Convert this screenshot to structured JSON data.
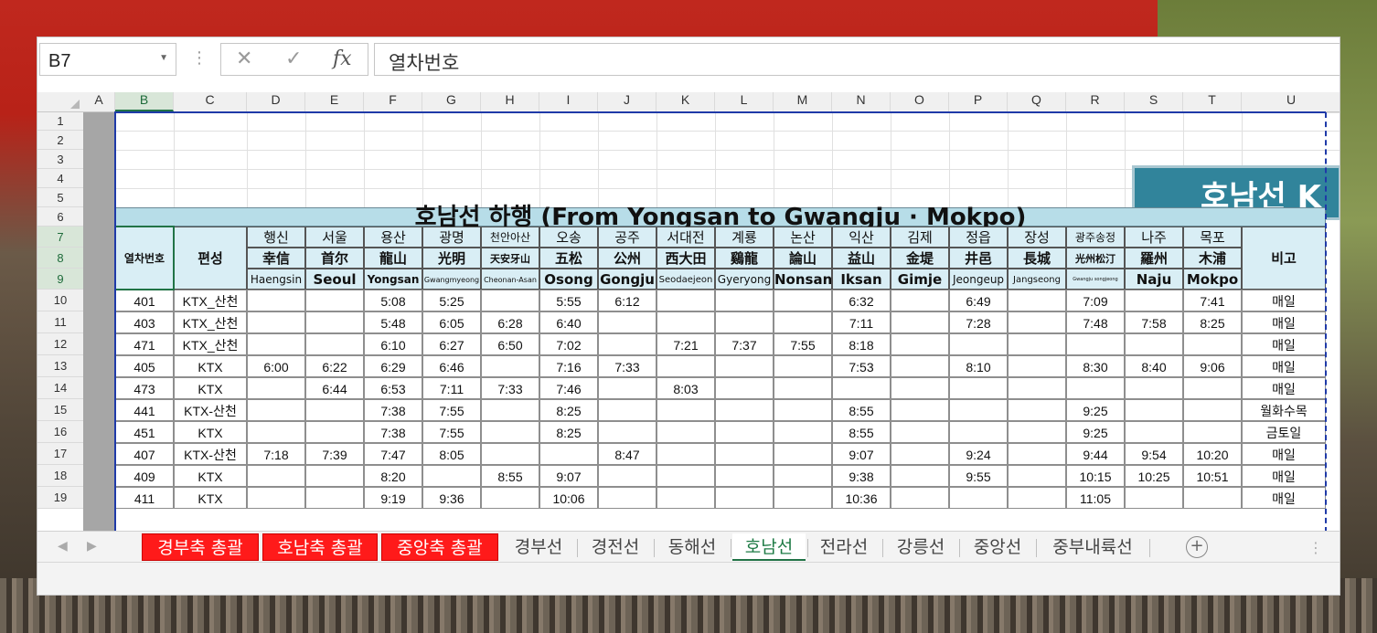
{
  "formula_bar": {
    "name_box": "B7",
    "formula": "열차번호"
  },
  "columns": [
    "A",
    "B",
    "C",
    "D",
    "E",
    "F",
    "G",
    "H",
    "I",
    "J",
    "K",
    "L",
    "M",
    "N",
    "O",
    "P",
    "Q",
    "R",
    "S",
    "T",
    "U"
  ],
  "rows": [
    "1",
    "2",
    "3",
    "4",
    "5",
    "6",
    "7",
    "8",
    "9",
    "10",
    "11",
    "12",
    "13",
    "14",
    "15",
    "16",
    "17",
    "18",
    "19"
  ],
  "banner": "호남선 K",
  "title": "호남선 하행 (From Yongsan to Gwangju · Mokpo)",
  "header": {
    "train_no": "열차번호",
    "train_type": "편성",
    "remarks": "비고",
    "stations": [
      {
        "ko": "행신",
        "hanja": "幸信",
        "en": "Haengsin"
      },
      {
        "ko": "서울",
        "hanja": "首尔",
        "en": "Seoul"
      },
      {
        "ko": "용산",
        "hanja": "龍山",
        "en": "Yongsan"
      },
      {
        "ko": "광명",
        "hanja": "光明",
        "en": "Gwangmyeong"
      },
      {
        "ko": "천안아산",
        "hanja": "天安牙山",
        "en": "Cheonan-Asan"
      },
      {
        "ko": "오송",
        "hanja": "五松",
        "en": "Osong"
      },
      {
        "ko": "공주",
        "hanja": "公州",
        "en": "Gongju"
      },
      {
        "ko": "서대전",
        "hanja": "西大田",
        "en": "Seodaejeon"
      },
      {
        "ko": "계룡",
        "hanja": "鷄龍",
        "en": "Gyeryong"
      },
      {
        "ko": "논산",
        "hanja": "論山",
        "en": "Nonsan"
      },
      {
        "ko": "익산",
        "hanja": "益山",
        "en": "Iksan"
      },
      {
        "ko": "김제",
        "hanja": "金堤",
        "en": "Gimje"
      },
      {
        "ko": "정읍",
        "hanja": "井邑",
        "en": "Jeongeup"
      },
      {
        "ko": "장성",
        "hanja": "長城",
        "en": "Jangseong"
      },
      {
        "ko": "광주송정",
        "hanja": "光州松汀",
        "en": "Gwangju songjeong"
      },
      {
        "ko": "나주",
        "hanja": "羅州",
        "en": "Naju"
      },
      {
        "ko": "목포",
        "hanja": "木浦",
        "en": "Mokpo"
      }
    ]
  },
  "timetable": [
    {
      "no": "401",
      "type": "KTX_산천",
      "times": [
        "",
        "",
        "5:08",
        "5:25",
        "",
        "5:55",
        "6:12",
        "",
        "",
        "",
        "6:32",
        "",
        "6:49",
        "",
        "7:09",
        "",
        "7:41"
      ],
      "remark": "매일"
    },
    {
      "no": "403",
      "type": "KTX_산천",
      "times": [
        "",
        "",
        "5:48",
        "6:05",
        "6:28",
        "6:40",
        "",
        "",
        "",
        "",
        "7:11",
        "",
        "7:28",
        "",
        "7:48",
        "7:58",
        "8:25"
      ],
      "remark": "매일"
    },
    {
      "no": "471",
      "type": "KTX_산천",
      "times": [
        "",
        "",
        "6:10",
        "6:27",
        "6:50",
        "7:02",
        "",
        "7:21",
        "7:37",
        "7:55",
        "8:18",
        "",
        "",
        "",
        "",
        "",
        ""
      ],
      "remark": "매일"
    },
    {
      "no": "405",
      "type": "KTX",
      "times": [
        "6:00",
        "6:22",
        "6:29",
        "6:46",
        "",
        "7:16",
        "7:33",
        "",
        "",
        "",
        "7:53",
        "",
        "8:10",
        "",
        "8:30",
        "8:40",
        "9:06"
      ],
      "remark": "매일"
    },
    {
      "no": "473",
      "type": "KTX",
      "times": [
        "",
        "6:44",
        "6:53",
        "7:11",
        "7:33",
        "7:46",
        "",
        "8:03",
        "",
        "",
        "",
        "",
        "",
        "",
        "",
        "",
        ""
      ],
      "remark": "매일"
    },
    {
      "no": "441",
      "type": "KTX-산천",
      "times": [
        "",
        "",
        "7:38",
        "7:55",
        "",
        "8:25",
        "",
        "",
        "",
        "",
        "8:55",
        "",
        "",
        "",
        "9:25",
        "",
        ""
      ],
      "remark": "월화수목"
    },
    {
      "no": "451",
      "type": "KTX",
      "times": [
        "",
        "",
        "7:38",
        "7:55",
        "",
        "8:25",
        "",
        "",
        "",
        "",
        "8:55",
        "",
        "",
        "",
        "9:25",
        "",
        ""
      ],
      "remark": "금토일"
    },
    {
      "no": "407",
      "type": "KTX-산천",
      "times": [
        "7:18",
        "7:39",
        "7:47",
        "8:05",
        "",
        "",
        "8:47",
        "",
        "",
        "",
        "9:07",
        "",
        "9:24",
        "",
        "9:44",
        "9:54",
        "10:20"
      ],
      "remark": "매일"
    },
    {
      "no": "409",
      "type": "KTX",
      "times": [
        "",
        "",
        "8:20",
        "",
        "8:55",
        "9:07",
        "",
        "",
        "",
        "",
        "9:38",
        "",
        "9:55",
        "",
        "10:15",
        "10:25",
        "10:51"
      ],
      "remark": "매일"
    },
    {
      "no": "411",
      "type": "KTX",
      "times": [
        "",
        "",
        "9:19",
        "9:36",
        "",
        "10:06",
        "",
        "",
        "",
        "",
        "10:36",
        "",
        "",
        "",
        "11:05",
        "",
        ""
      ],
      "remark": "매일"
    }
  ],
  "sheet_tabs": [
    {
      "label": "경부축 총괄",
      "style": "red"
    },
    {
      "label": "호남축 총괄",
      "style": "red"
    },
    {
      "label": "중앙축 총괄",
      "style": "red"
    },
    {
      "label": "경부선",
      "style": "normal"
    },
    {
      "label": "경전선",
      "style": "normal"
    },
    {
      "label": "동해선",
      "style": "normal"
    },
    {
      "label": "호남선",
      "style": "active"
    },
    {
      "label": "전라선",
      "style": "normal"
    },
    {
      "label": "강릉선",
      "style": "normal"
    },
    {
      "label": "중앙선",
      "style": "normal"
    },
    {
      "label": "중부내륙선",
      "style": "normal"
    }
  ],
  "add_sheet": "+"
}
